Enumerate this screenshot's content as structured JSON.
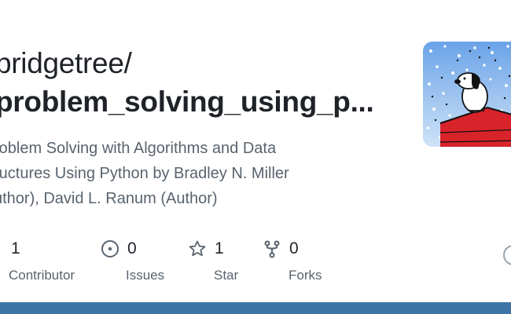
{
  "repo": {
    "owner": "bridgetree/",
    "name": "problem_solving_using_p...",
    "description_lines": [
      "roblem Solving with Algorithms and Data",
      "ructures Using Python by Bradley N. Miller",
      "uthor), David L. Ranum (Author)"
    ]
  },
  "stats": [
    {
      "icon": "people-icon",
      "value": "1",
      "label": "Contributor"
    },
    {
      "icon": "issue-icon",
      "value": "0",
      "label": "Issues"
    },
    {
      "icon": "star-icon",
      "value": "1",
      "label": "Star"
    },
    {
      "icon": "fork-icon",
      "value": "0",
      "label": "Forks"
    }
  ],
  "colors": {
    "text_primary": "#1f2328",
    "text_muted": "#59636e",
    "bottom_bar": "#3e74a6"
  }
}
